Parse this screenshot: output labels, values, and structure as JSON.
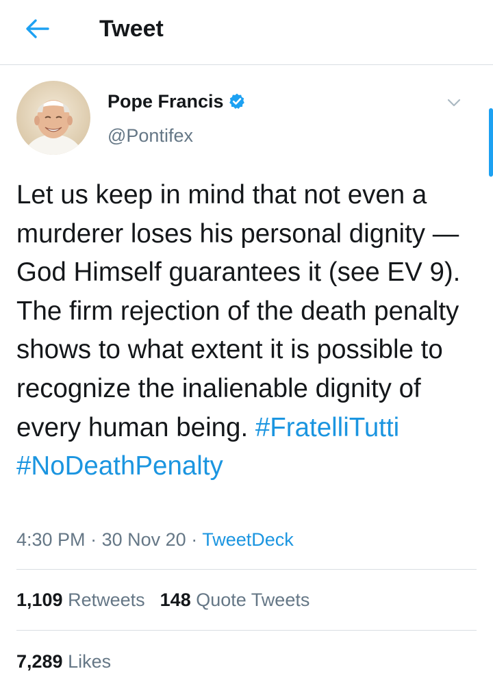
{
  "header": {
    "title": "Tweet",
    "back_icon": "arrow-left-icon",
    "accent_color": "#1da1f2"
  },
  "tweet": {
    "author": {
      "name": "Pope Francis",
      "handle": "@Pontifex",
      "verified_icon": "verified-badge-icon",
      "avatar_icon": "avatar-photo"
    },
    "text": "Let us keep in mind that not even a murderer loses his personal dignity — God Himself guarantees it (see EV 9). The firm rejection of the death penalty shows to what extent it is possible to recognize the inalienable dignity of every human being.",
    "hashtags": [
      "#FratelliTutti",
      "#NoDeathPenalty"
    ],
    "time": "4:30 PM",
    "separator": "·",
    "date": "30 Nov 20",
    "source": "TweetDeck",
    "more_icon": "chevron-down-icon"
  },
  "stats": {
    "retweets_count": "1,109",
    "retweets_label": "Retweets",
    "quote_count": "148",
    "quote_label": "Quote Tweets",
    "likes_count": "7,289",
    "likes_label": "Likes"
  },
  "colors": {
    "text": "#14171a",
    "secondary": "#657786",
    "link": "#1b95e0",
    "divider": "#d8dde2"
  }
}
